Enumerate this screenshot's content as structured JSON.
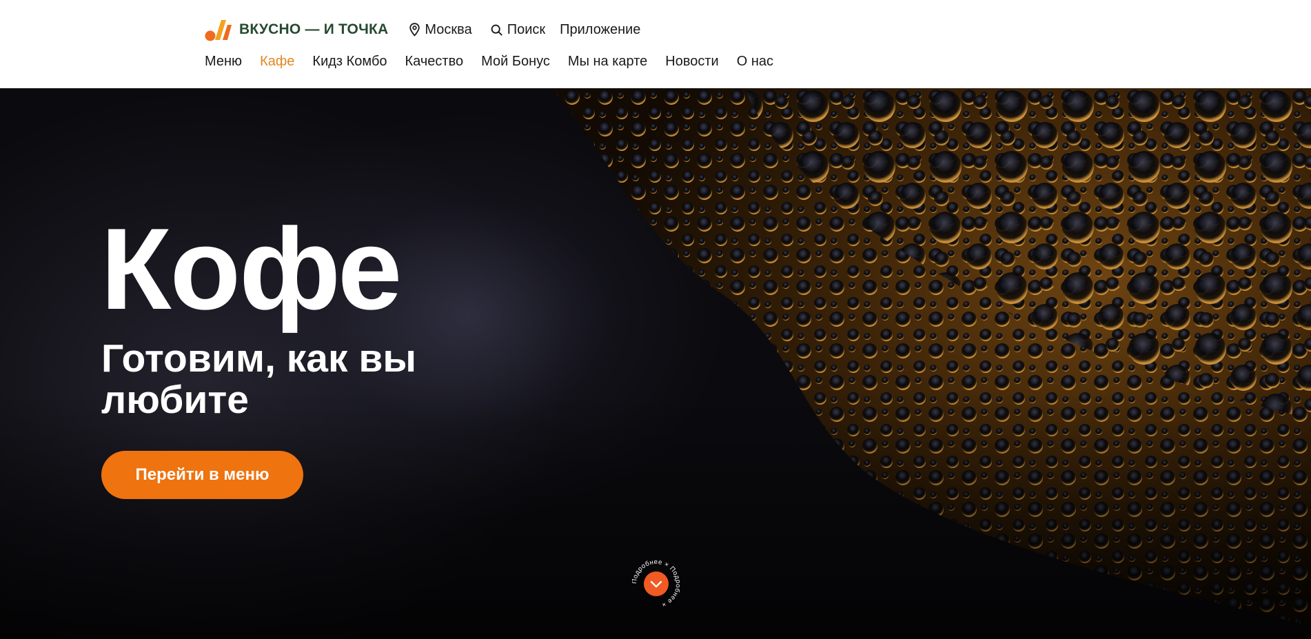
{
  "header": {
    "brand": "ВКУСНО — И ТОЧКА",
    "location": "Москва",
    "search": "Поиск",
    "app": "Приложение"
  },
  "nav": {
    "items": [
      {
        "label": "Меню",
        "active": false
      },
      {
        "label": "Кафе",
        "active": true
      },
      {
        "label": "Кидз Комбо",
        "active": false
      },
      {
        "label": "Качество",
        "active": false
      },
      {
        "label": "Мой Бонус",
        "active": false
      },
      {
        "label": "Мы на карте",
        "active": false
      },
      {
        "label": "Новости",
        "active": false
      },
      {
        "label": "О нас",
        "active": false
      }
    ]
  },
  "hero": {
    "title": "Кофе",
    "subtitle": "Готовим, как вы любите",
    "cta_label": "Перейти в меню",
    "scroll_label": "Подробнее × Подробнее ×"
  },
  "colors": {
    "accent": "#ef730f",
    "active_nav": "#e3861f",
    "brand_text": "#264a30",
    "scroll_button": "#f15a22"
  },
  "icons": {
    "logo": "logo-mark-icon",
    "location": "location-pin-icon",
    "search": "search-icon",
    "scroll": "chevron-down-icon"
  }
}
